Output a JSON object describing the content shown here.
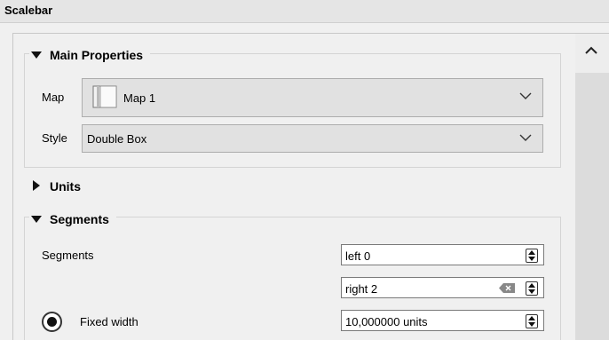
{
  "panel": {
    "title": "Scalebar"
  },
  "main_properties": {
    "title": "Main Properties",
    "map_label": "Map",
    "map_value": "Map 1",
    "style_label": "Style",
    "style_value": "Double Box"
  },
  "units": {
    "title": "Units"
  },
  "segments": {
    "title": "Segments",
    "segments_label": "Segments",
    "left_value": "left 0",
    "right_value": "right 2",
    "fixed_width_label": "Fixed width",
    "fixed_width_value": "10,000000 units"
  },
  "icons": {
    "collapse": "triangle-down-icon",
    "expand": "triangle-right-icon",
    "scroll_up": "chevron-up-icon",
    "dropdown": "chevron-down-icon",
    "map": "map-icon",
    "clear": "clear-icon",
    "spin": "spin-arrows-icon"
  }
}
